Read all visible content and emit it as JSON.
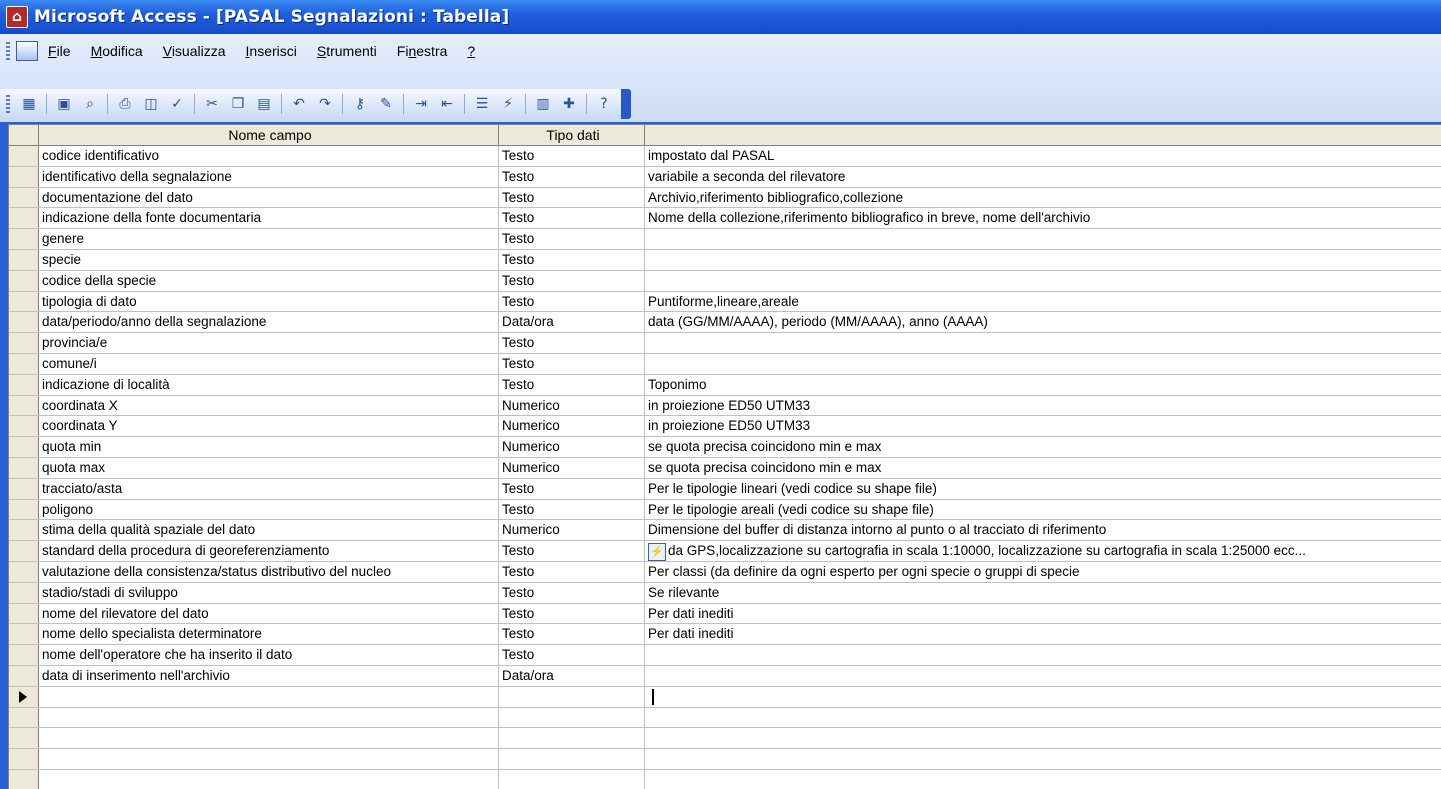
{
  "window": {
    "title": "Microsoft Access - [PASAL Segnalazioni : Tabella]"
  },
  "menu": {
    "items": [
      {
        "label": "File",
        "underline": "F",
        "rest": "ile"
      },
      {
        "label": "Modifica",
        "underline": "M",
        "rest": "odifica"
      },
      {
        "label": "Visualizza",
        "underline": "V",
        "rest": "isualizza"
      },
      {
        "label": "Inserisci",
        "underline": "I",
        "rest": "nserisci"
      },
      {
        "label": "Strumenti",
        "underline": "S",
        "rest": "trumenti"
      },
      {
        "label": "Finestra",
        "pre": "Fi",
        "underline": "n",
        "rest": "estra"
      },
      {
        "label": "?",
        "underline": "?",
        "rest": ""
      }
    ]
  },
  "toolbar": {
    "icons": [
      "view-icon",
      "save-icon",
      "search-icon",
      "print-icon",
      "print-preview-icon",
      "spelling-icon",
      "cut-icon",
      "copy-icon",
      "paste-icon",
      "undo-icon",
      "redo-icon",
      "primary-key-icon",
      "builder-icon",
      "insert-rows-icon",
      "delete-rows-icon",
      "properties-icon",
      "indexes-icon",
      "database-window-icon",
      "new-object-icon",
      "help-icon"
    ]
  },
  "table": {
    "headers": {
      "field_name": "Nome campo",
      "data_type": "Tipo dati",
      "description": ""
    },
    "rows": [
      {
        "name": "codice identificativo",
        "type": "Testo",
        "desc": "impostato dal PASAL"
      },
      {
        "name": "identificativo della segnalazione",
        "type": "Testo",
        "desc": "variabile a seconda del rilevatore"
      },
      {
        "name": "documentazione del dato",
        "type": "Testo",
        "desc": "Archivio,riferimento bibliografico,collezione"
      },
      {
        "name": "indicazione della fonte documentaria",
        "type": "Testo",
        "desc": "Nome della collezione,riferimento bibliografico in breve, nome dell'archivio"
      },
      {
        "name": "genere",
        "type": "Testo",
        "desc": ""
      },
      {
        "name": "specie",
        "type": "Testo",
        "desc": ""
      },
      {
        "name": "codice della specie",
        "type": "Testo",
        "desc": ""
      },
      {
        "name": "tipologia di dato",
        "type": "Testo",
        "desc": "Puntiforme,lineare,areale"
      },
      {
        "name": "data/periodo/anno della segnalazione",
        "type": "Data/ora",
        "desc": "data (GG/MM/AAAA), periodo (MM/AAAA), anno (AAAA)"
      },
      {
        "name": "provincia/e",
        "type": "Testo",
        "desc": ""
      },
      {
        "name": "comune/i",
        "type": "Testo",
        "desc": ""
      },
      {
        "name": "indicazione di località",
        "type": "Testo",
        "desc": "Toponimo"
      },
      {
        "name": "coordinata X",
        "type": "Numerico",
        "desc": "in proiezione ED50 UTM33"
      },
      {
        "name": "coordinata Y",
        "type": "Numerico",
        "desc": "in proiezione ED50 UTM33"
      },
      {
        "name": "quota min",
        "type": "Numerico",
        "desc": "se quota precisa coincidono min e max"
      },
      {
        "name": "quota max",
        "type": "Numerico",
        "desc": "se quota precisa coincidono min e max"
      },
      {
        "name": "tracciato/asta",
        "type": "Testo",
        "desc": "Per le tipologie lineari (vedi codice su shape file)"
      },
      {
        "name": "poligono",
        "type": "Testo",
        "desc": "Per le tipologie areali (vedi codice su shape file)"
      },
      {
        "name": "stima della qualità spaziale del dato",
        "type": "Numerico",
        "desc": "Dimensione del buffer di distanza intorno al punto o al tracciato di riferimento"
      },
      {
        "name": "standard della procedura di georeferenziamento",
        "type": "Testo",
        "desc": "da GPS,localizzazione su cartografia in scala 1:10000, localizzazione su cartografia in scala 1:25000 ecc..."
      },
      {
        "name": "valutazione della consistenza/status distributivo del nucleo",
        "type": "Testo",
        "desc": "Per classi (da definire da ogni esperto per ogni specie o gruppi di specie"
      },
      {
        "name": "stadio/stadi di sviluppo",
        "type": "Testo",
        "desc": "Se rilevante"
      },
      {
        "name": "nome del rilevatore del dato",
        "type": "Testo",
        "desc": "Per dati inediti"
      },
      {
        "name": "nome dello specialista determinatore",
        "type": "Testo",
        "desc": "Per dati inediti"
      },
      {
        "name": "nome dell'operatore che ha inserito il dato",
        "type": "Testo",
        "desc": ""
      },
      {
        "name": "data di inserimento nell'archivio",
        "type": "Data/ora",
        "desc": ""
      }
    ]
  }
}
